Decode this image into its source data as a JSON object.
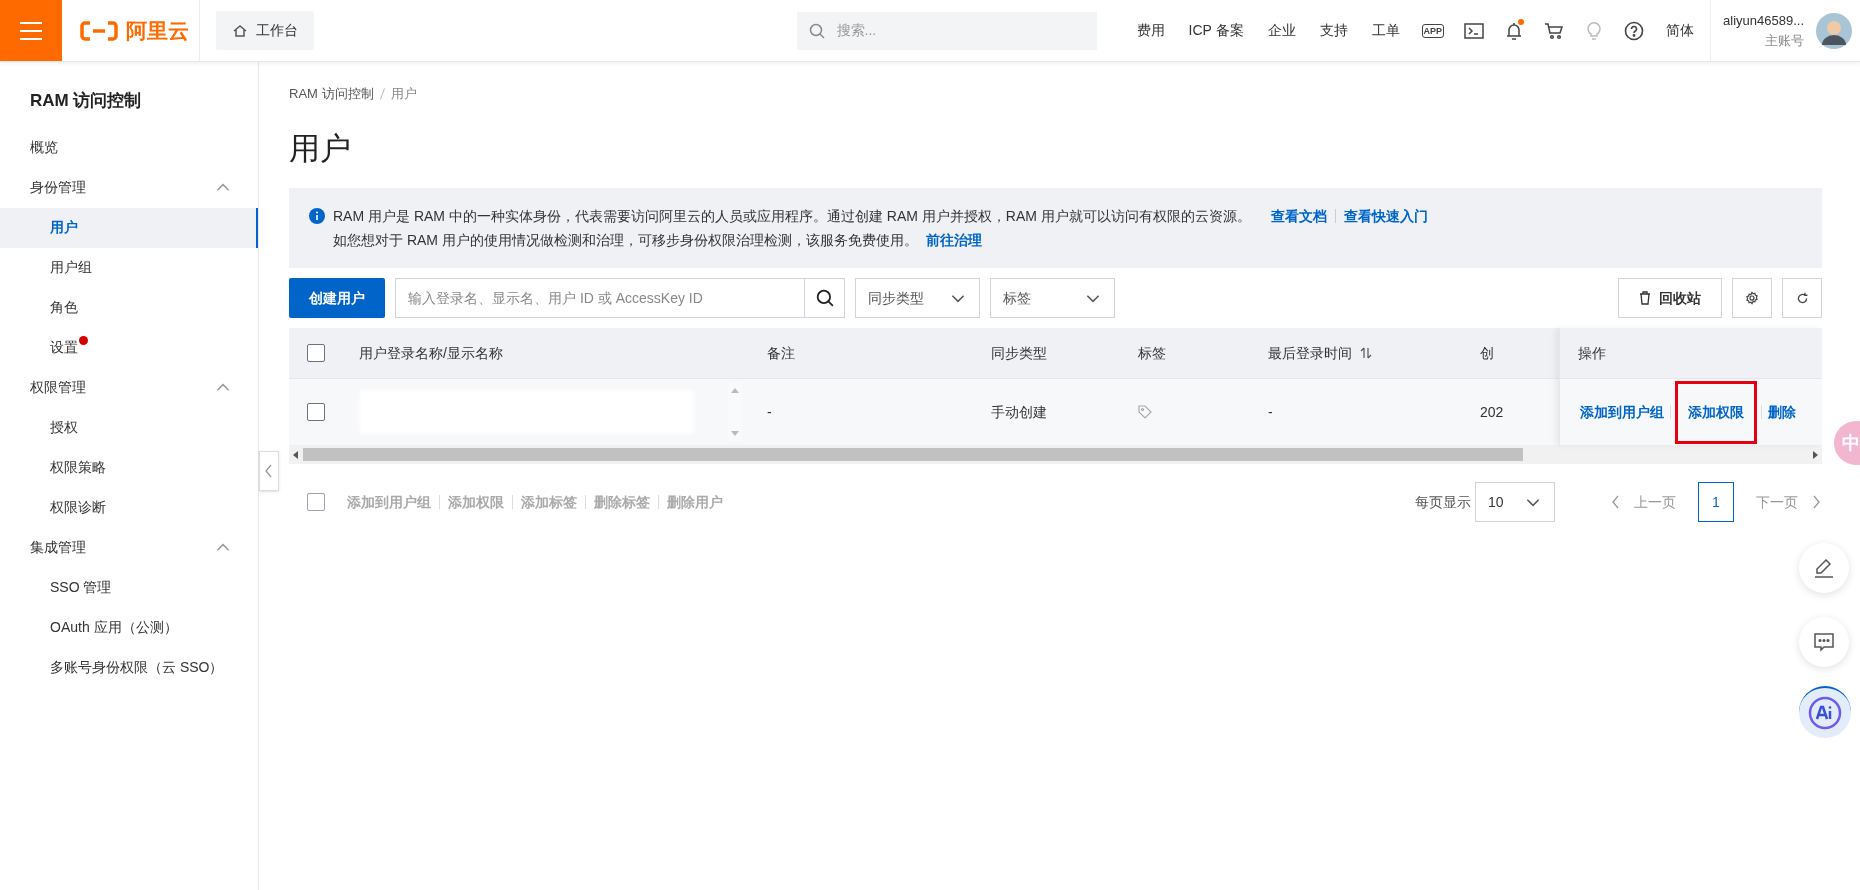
{
  "header": {
    "logo": "阿里云",
    "workbench": "工作台",
    "search": {
      "placeholder": "搜索..."
    },
    "nav": [
      "费用",
      "ICP 备案",
      "企业",
      "支持",
      "工单"
    ],
    "app_icon_text": "APP",
    "notification_dot": true,
    "language": "简体",
    "account": {
      "name": "aliyun46589...",
      "role": "主账号"
    }
  },
  "sidebar": {
    "title": "RAM 访问控制",
    "items": [
      {
        "label": "概览",
        "selected": false,
        "badge": false
      },
      {
        "label": "身份管理",
        "expanded": true,
        "children": [
          {
            "label": "用户",
            "selected": true,
            "badge": false
          },
          {
            "label": "用户组",
            "selected": false,
            "badge": false
          },
          {
            "label": "角色",
            "selected": false,
            "badge": false
          },
          {
            "label": "设置",
            "selected": false,
            "badge": true
          }
        ]
      },
      {
        "label": "权限管理",
        "expanded": true,
        "children": [
          {
            "label": "授权",
            "selected": false,
            "badge": false
          },
          {
            "label": "权限策略",
            "selected": false,
            "badge": false
          },
          {
            "label": "权限诊断",
            "selected": false,
            "badge": false
          }
        ]
      },
      {
        "label": "集成管理",
        "expanded": true,
        "children": [
          {
            "label": "SSO 管理",
            "selected": false,
            "badge": false
          },
          {
            "label": "OAuth 应用（公测）",
            "selected": false,
            "badge": false
          },
          {
            "label": "多账号身份权限（云 SSO）",
            "selected": false,
            "badge": false
          }
        ]
      }
    ]
  },
  "breadcrumb": [
    "RAM 访问控制",
    "用户"
  ],
  "page_title": "用户",
  "notice": {
    "lines": [
      {
        "text": "RAM 用户是 RAM 中的一种实体身份，代表需要访问阿里云的人员或应用程序。通过创建 RAM 用户并授权，RAM 用户就可以访问有权限的云资源。",
        "links": [
          "查看文档",
          "查看快速入门"
        ]
      },
      {
        "text": "如您想对于 RAM 用户的使用情况做检测和治理，可移步身份权限治理检测，该服务免费使用。",
        "links": [
          "前往治理"
        ]
      }
    ]
  },
  "toolbar": {
    "create_button": "创建用户",
    "search": {
      "placeholder": "输入登录名、显示名、用户 ID 或 AccessKey ID"
    },
    "filters": [
      "同步类型",
      "标签"
    ],
    "recycle_button": "回收站"
  },
  "table": {
    "header_checked": false,
    "columns": [
      {
        "label": "用户登录名称/显示名称",
        "sortable": false
      },
      {
        "label": "备注",
        "sortable": false
      },
      {
        "label": "同步类型",
        "sortable": false
      },
      {
        "label": "标签",
        "sortable": false
      },
      {
        "label": "最后登录时间",
        "sortable": true
      },
      {
        "label": "创",
        "sortable": false
      }
    ],
    "action_column": "操作",
    "rows": [
      {
        "checked": false,
        "note": "-",
        "sync_type": "手动创建",
        "last_login": "-",
        "created": "202",
        "actions": [
          {
            "label": "添加到用户组",
            "highlighted": false
          },
          {
            "label": "添加权限",
            "highlighted": true
          },
          {
            "label": "删除",
            "highlighted": false
          }
        ]
      }
    ]
  },
  "bulk": {
    "checked": false,
    "disabled": true,
    "actions": [
      "添加到用户组",
      "添加权限",
      "添加标签",
      "删除标签",
      "删除用户"
    ]
  },
  "pagination": {
    "label": "每页显示",
    "page_size": "10",
    "prev": "上一页",
    "prev_disabled": true,
    "pages": [
      {
        "label": "1",
        "selected": true
      }
    ],
    "next": "下一页",
    "next_disabled": true
  },
  "ime_badge": "中"
}
